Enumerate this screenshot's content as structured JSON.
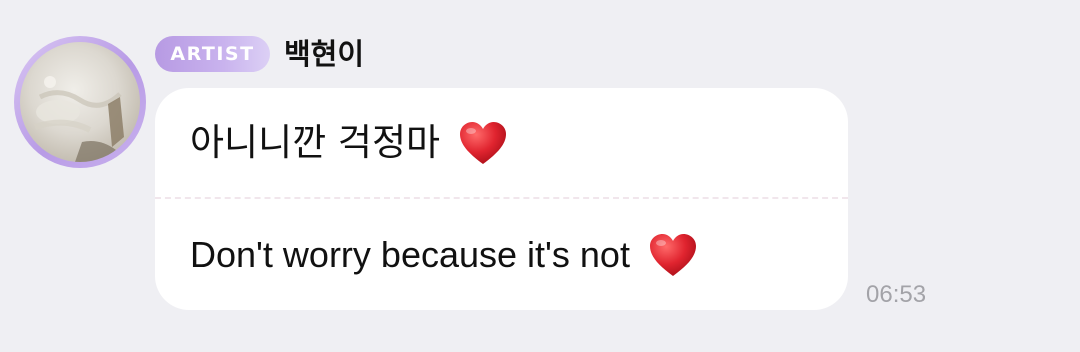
{
  "sender": {
    "badge": "ARTIST",
    "name": "백현이",
    "avatar_icon": "avatar-photo"
  },
  "message": {
    "original": "아니니깐 걱정마",
    "translation": "Don't worry because it's not",
    "emoji": "red-heart",
    "time": "06:53"
  },
  "colors": {
    "background": "#efeff3",
    "bubble": "#ffffff",
    "badge_accent": "#b79ae3",
    "heart": "#e0242f",
    "timestamp": "#a3a3a8"
  }
}
